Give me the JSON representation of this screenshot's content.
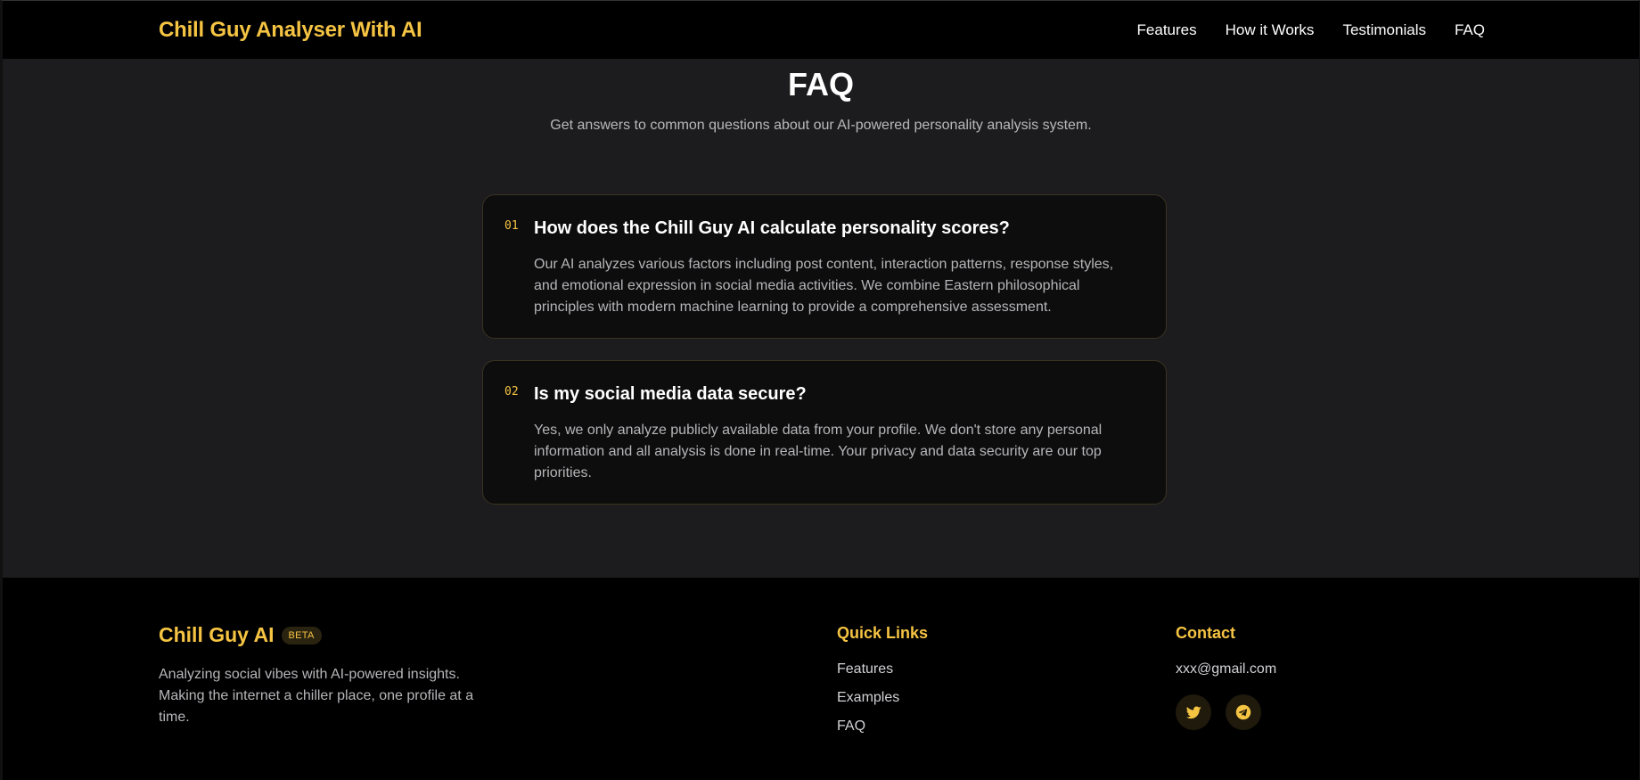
{
  "header": {
    "brand": "Chill Guy Analyser With AI",
    "nav": [
      "Features",
      "How it Works",
      "Testimonials",
      "FAQ"
    ]
  },
  "faq": {
    "title": "FAQ",
    "subtitle": "Get answers to common questions about our AI-powered personality analysis system.",
    "items": [
      {
        "number": "01",
        "question": "How does the Chill Guy AI calculate personality scores?",
        "answer": "Our AI analyzes various factors including post content, interaction patterns, response styles, and emotional expression in social media activities. We combine Eastern philosophical principles with modern machine learning to provide a comprehensive assessment."
      },
      {
        "number": "02",
        "question": "Is my social media data secure?",
        "answer": "Yes, we only analyze publicly available data from your profile. We don't store any personal information and all analysis is done in real-time. Your privacy and data security are our top priorities."
      }
    ]
  },
  "footer": {
    "brand": "Chill Guy AI",
    "badge": "BETA",
    "description": "Analyzing social vibes with AI-powered insights. Making the internet a chiller place, one profile at a time.",
    "quick_links": {
      "title": "Quick Links",
      "items": [
        "Features",
        "Examples",
        "FAQ"
      ]
    },
    "contact": {
      "title": "Contact",
      "email": "xxx@gmail.com",
      "socials": [
        "twitter-icon",
        "telegram-icon"
      ]
    }
  },
  "colors": {
    "accent": "#f6c443",
    "header_bg": "#000000",
    "section_bg": "#1c1c1e",
    "card_bg": "#0d0d0d"
  }
}
